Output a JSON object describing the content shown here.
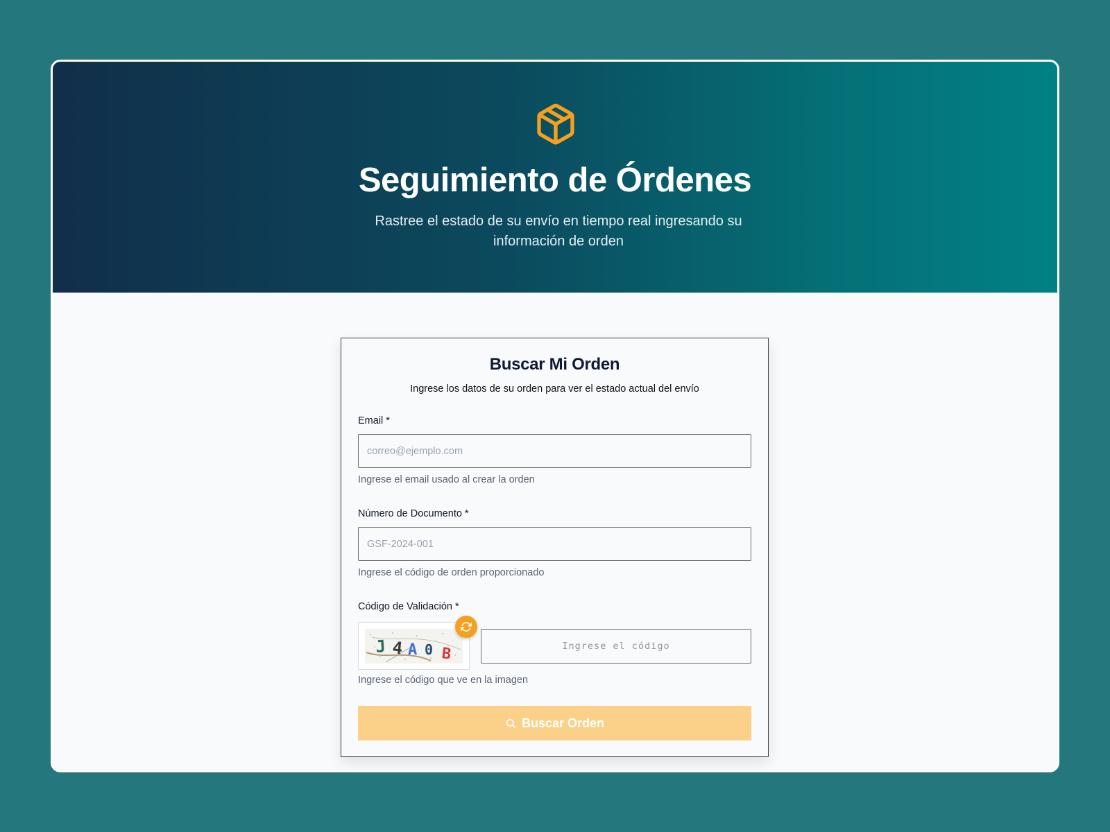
{
  "hero": {
    "icon": "package-box-icon",
    "title": "Seguimiento de Órdenes",
    "subtitle": "Rastree el estado de su envío en tiempo real ingresando su información de orden"
  },
  "form": {
    "title": "Buscar Mi Orden",
    "description": "Ingrese los datos de su orden para ver el estado actual del envío",
    "email": {
      "label": "Email *",
      "placeholder": "correo@ejemplo.com",
      "value": "",
      "helper": "Ingrese el email usado al crear la orden"
    },
    "document": {
      "label": "Número de Documento *",
      "placeholder": "GSF-2024-001",
      "value": "",
      "helper": "Ingrese el código de orden proporcionado"
    },
    "captcha": {
      "label": "Código de Validación *",
      "image_text": "J4A0B",
      "refresh_icon": "refresh-icon",
      "placeholder": "Ingrese el código",
      "value": "",
      "helper": "Ingrese el código que ve en la imagen"
    },
    "submit": {
      "icon": "search-icon",
      "label": "Buscar Orden"
    }
  },
  "colors": {
    "background": "#23777d",
    "hero_gradient_start": "#112e4a",
    "hero_gradient_end": "#018184",
    "accent": "#f5a01e",
    "button_disabled": "#fbd089"
  }
}
